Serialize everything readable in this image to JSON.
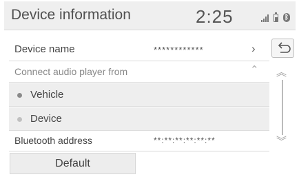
{
  "header": {
    "title": "Device information",
    "clock": "2:25",
    "icons": [
      "signal-icon",
      "battery-icon",
      "bluetooth-icon"
    ]
  },
  "rows": {
    "device_name": {
      "label": "Device name",
      "value": "************"
    },
    "connect_audio": {
      "label": "Connect audio player from"
    },
    "options": [
      {
        "label": "Vehicle",
        "selected": true
      },
      {
        "label": "Device",
        "selected": false
      }
    ],
    "bluetooth_address": {
      "label": "Bluetooth address",
      "value": "**:**:**:**:**:**"
    }
  },
  "actions": {
    "default_label": "Default"
  },
  "side": {
    "icons": [
      "back-icon",
      "scroll-up-icon",
      "scroll-down-icon"
    ]
  }
}
